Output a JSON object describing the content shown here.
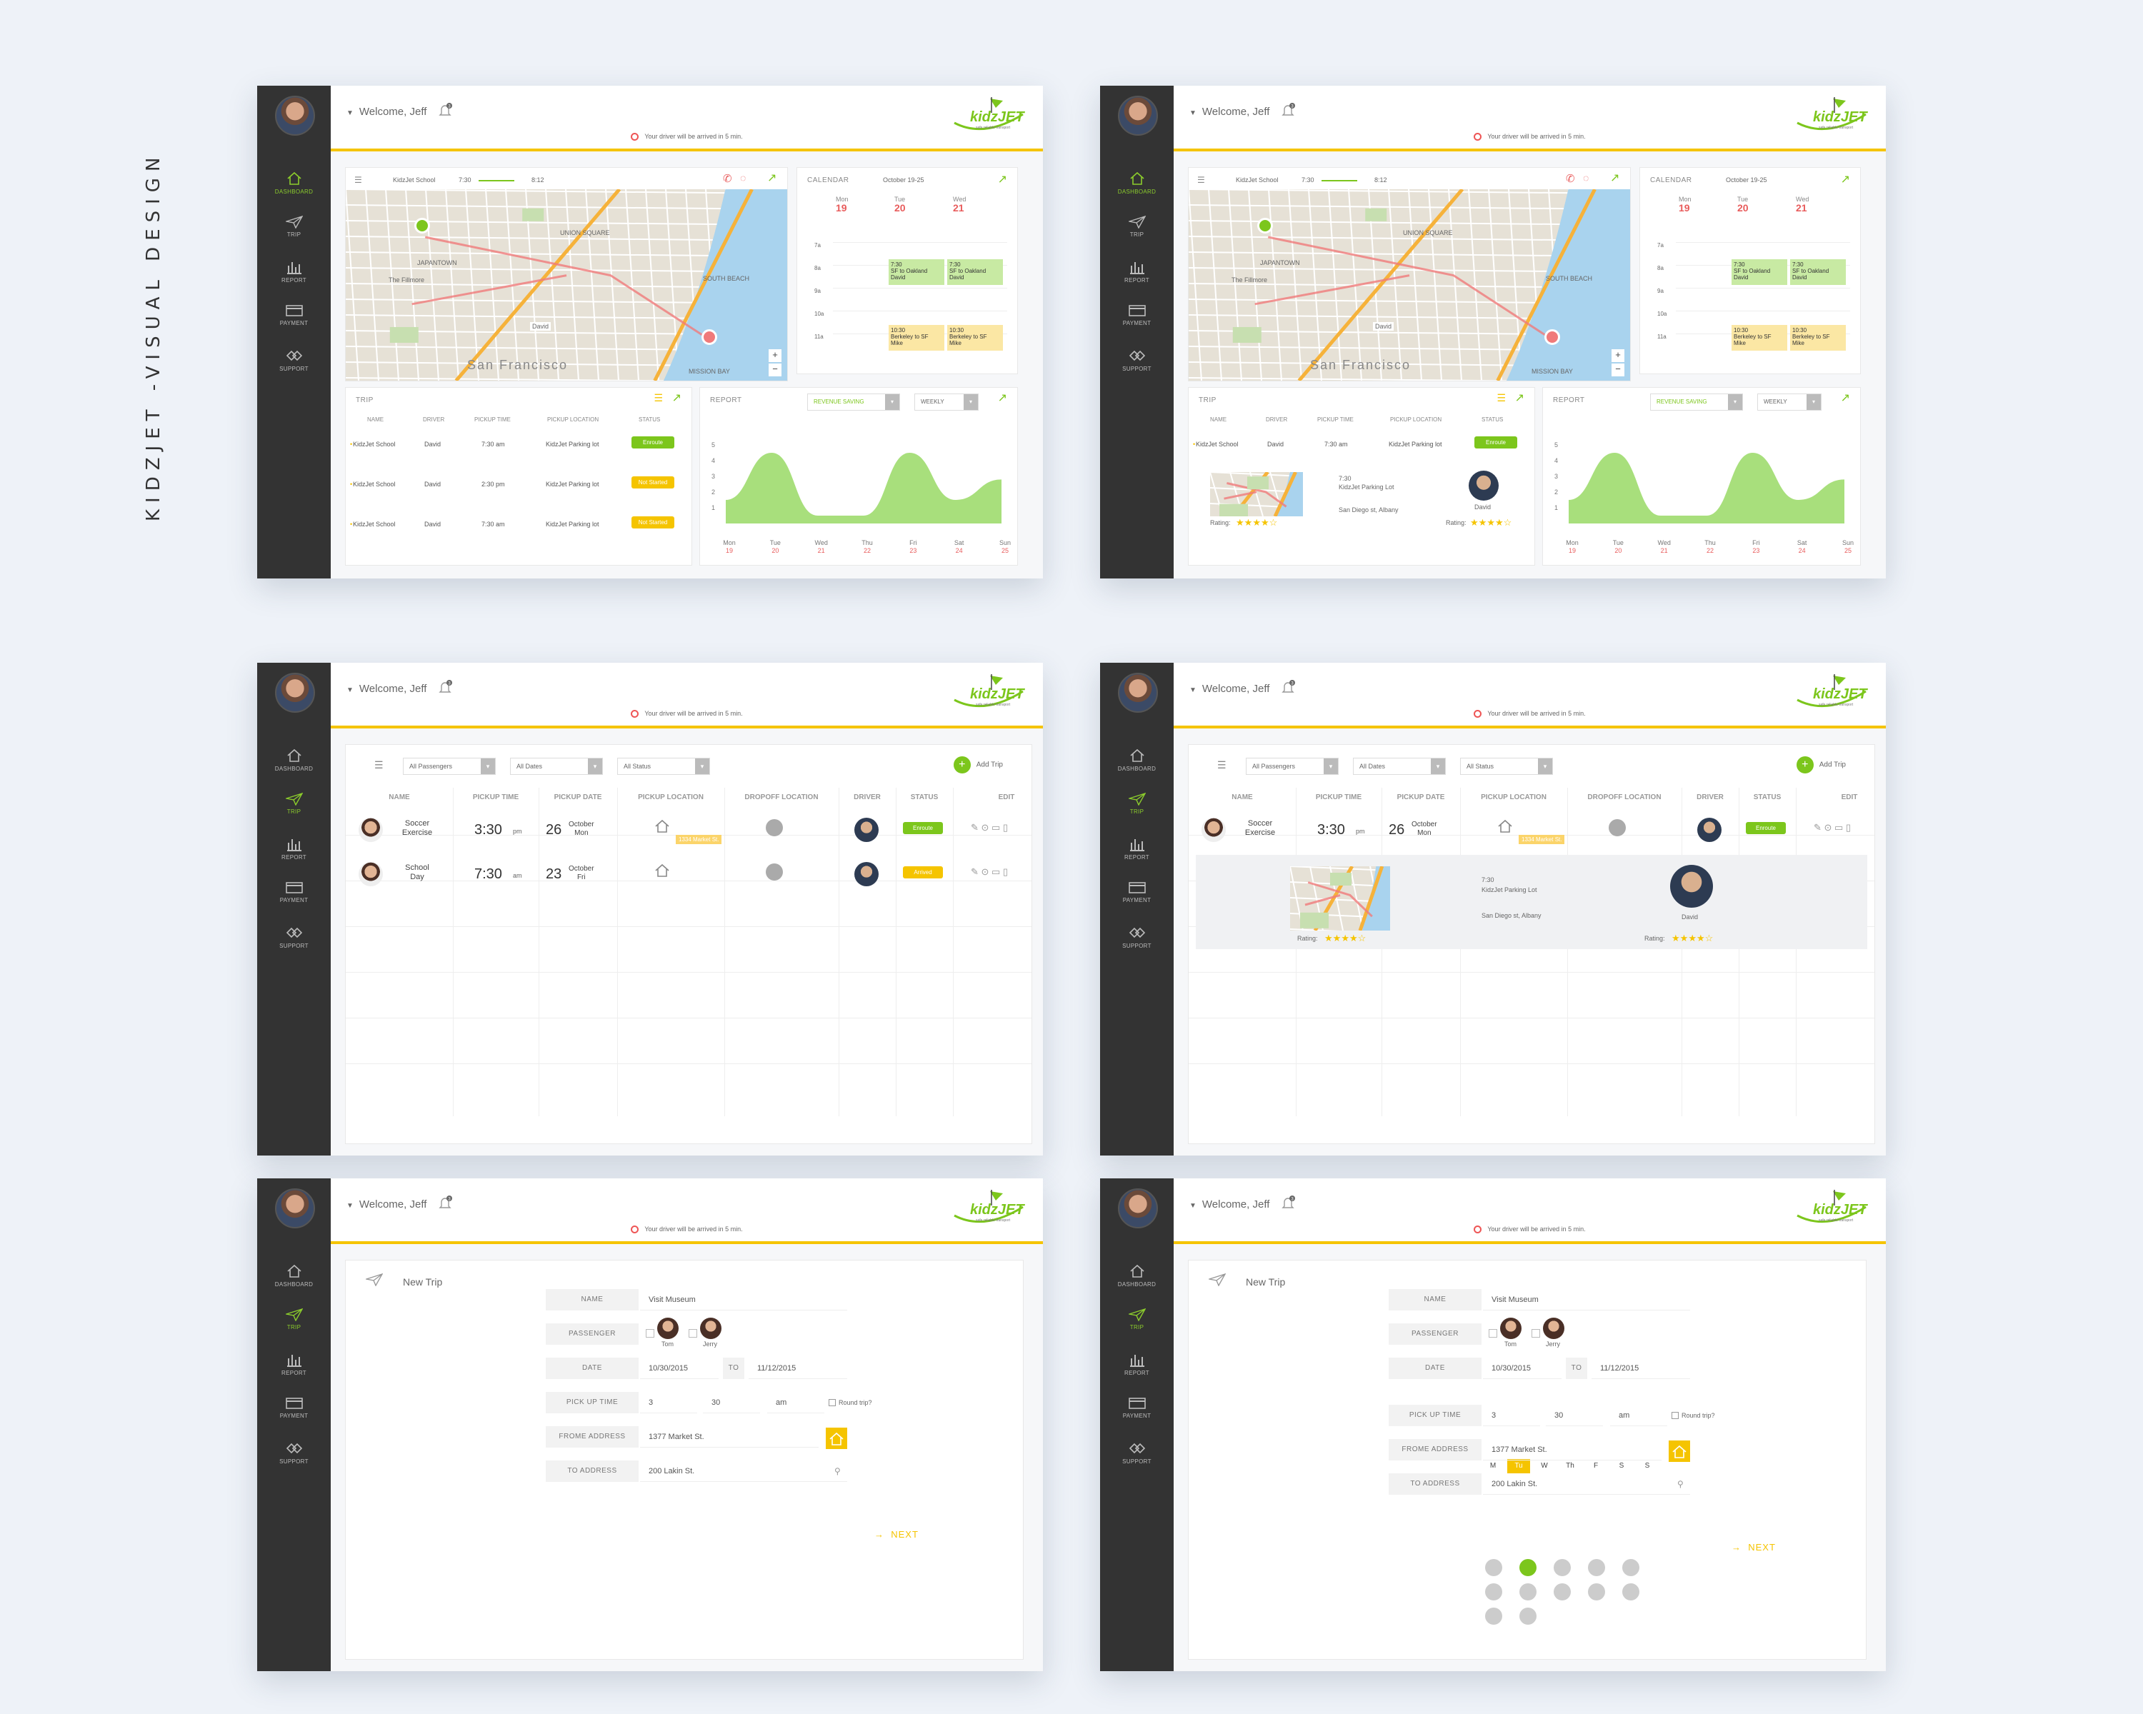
{
  "page_title": "KIDZJET -VISUAL DESIGN",
  "common": {
    "welcome": "Welcome, Jeff",
    "notification_count": "3",
    "notice": "Your driver will be arrived in 5 min.",
    "logo_text": "kidzJET",
    "logo_tagline": "safe reliable transport",
    "nav": [
      "DASHBOARD",
      "TRIP",
      "REPORT",
      "PAYMENT",
      "SUPPORT"
    ],
    "colors": {
      "accent_green": "#7cc61c",
      "accent_yellow": "#f5c400",
      "sidebar": "#333333",
      "alert_red": "#e85c5c"
    }
  },
  "dashboard": {
    "map_bar": {
      "school": "KidzJet School",
      "start": "7:30",
      "end": "8:12"
    },
    "map_labels": [
      "The Fillmore",
      "San Francisco",
      "SOUTH BEACH",
      "UNION SQUARE",
      "JAPANTOWN",
      "MISSION BAY",
      "David"
    ],
    "calendar": {
      "title": "CALENDAR",
      "range": "October 19-25",
      "days": [
        {
          "dow": "Mon",
          "date": "19"
        },
        {
          "dow": "Tue",
          "date": "20"
        },
        {
          "dow": "Wed",
          "date": "21"
        }
      ],
      "hours": [
        "7a",
        "8a",
        "9a",
        "10a",
        "11a"
      ],
      "events": [
        {
          "time": "7:30",
          "title": "SF to Oakland",
          "who": "David",
          "kind": "green"
        },
        {
          "time": "7:30",
          "title": "SF to Oakland",
          "who": "David",
          "kind": "green"
        },
        {
          "time": "10:30",
          "title": "Berkeley to SF",
          "who": "Mike",
          "kind": "yellow"
        },
        {
          "time": "10:30",
          "title": "Berkeley to SF",
          "who": "Mike",
          "kind": "yellow"
        }
      ]
    },
    "trip": {
      "title": "TRIP",
      "headers": [
        "NAME",
        "DRIVER",
        "PICKUP TIME",
        "PICKUP LOCATION",
        "STATUS"
      ],
      "rows": [
        {
          "name": "KidzJet School",
          "driver": "David",
          "time": "7:30 am",
          "location": "KidzJet Parking lot",
          "status": "Enroute",
          "kind": "green"
        },
        {
          "name": "KidzJet School",
          "driver": "David",
          "time": "2:30 pm",
          "location": "KidzJet Parking lot",
          "status": "Not Started",
          "kind": "yellow"
        },
        {
          "name": "KidzJet School",
          "driver": "David",
          "time": "7:30 am",
          "location": "KidzJet Parking lot",
          "status": "Not Started",
          "kind": "yellow"
        }
      ],
      "detail": {
        "time": "7:30",
        "from": "KidzJet Parking Lot",
        "to": "San Diego st, Albany",
        "driver": "David",
        "rating_label": "Rating:",
        "rating": 4
      }
    },
    "report": {
      "title": "REPORT",
      "legend": "REVENUE SAVING",
      "period": "WEEKLY"
    },
    "chart_data": {
      "type": "area",
      "categories": [
        "Mon 19",
        "Tue 20",
        "Wed 21",
        "Thu 22",
        "Fri 23",
        "Sat 24",
        "Sun 25"
      ],
      "x_days": [
        "Mon",
        "Tue",
        "Wed",
        "Thu",
        "Fri",
        "Sat",
        "Sun"
      ],
      "x_dates": [
        "19",
        "20",
        "21",
        "22",
        "23",
        "24",
        "25"
      ],
      "values": [
        1.5,
        4.5,
        0.5,
        0.5,
        4.5,
        1.5,
        2.8
      ],
      "y_ticks": [
        "1",
        "2",
        "3",
        "4",
        "5"
      ],
      "ylim": [
        0,
        5
      ],
      "series": [
        {
          "name": "REVENUE SAVING",
          "color": "#a8df7c"
        }
      ]
    }
  },
  "trips_list": {
    "filters": [
      "All Passengers",
      "All Dates",
      "All Status"
    ],
    "add_label": "Add Trip",
    "headers": [
      "NAME",
      "PICKUP TIME",
      "PICKUP DATE",
      "PICKUP LOCATION",
      "DROPOFF LOCATION",
      "DRIVER",
      "STATUS",
      "EDIT"
    ],
    "rows": [
      {
        "name1": "Soccer",
        "name2": "Exercise",
        "time": "3:30",
        "ampm": "pm",
        "day": "26",
        "month": "October",
        "dow": "Mon",
        "tag": "1334 Market St.",
        "status": "Enroute",
        "kind": "green"
      },
      {
        "name1": "School",
        "name2": "Day",
        "time": "7:30",
        "ampm": "am",
        "day": "23",
        "month": "October",
        "dow": "Fri",
        "tag": "",
        "status": "Arrived",
        "kind": "yellow"
      }
    ],
    "detail": {
      "time": "7:30",
      "from": "KidzJet Parking Lot",
      "to": "San Diego st, Albany",
      "driver": "David",
      "rating_label": "Rating:",
      "rating": 4
    }
  },
  "new_trip": {
    "title": "New Trip",
    "labels": {
      "name": "NAME",
      "passenger": "PASSENGER",
      "date": "DATE",
      "to": "TO",
      "pickup": "PICK UP TIME",
      "from_address": "FROME ADDRESS",
      "to_address": "TO ADDRESS"
    },
    "name_value": "Visit Museum",
    "passengers": [
      "Tom",
      "Jerry"
    ],
    "date_from": "10/30/2015",
    "date_to": "11/12/2015",
    "hour": "3",
    "minute": "30",
    "ampm": "am",
    "round_trip": "Round trip?",
    "from_value": "1377 Market St.",
    "to_value": "200 Lakin St.",
    "next": "NEXT",
    "weekdays": [
      "M",
      "Tu",
      "W",
      "Th",
      "F",
      "S",
      "S"
    ],
    "selected_weekday": "Tu"
  }
}
